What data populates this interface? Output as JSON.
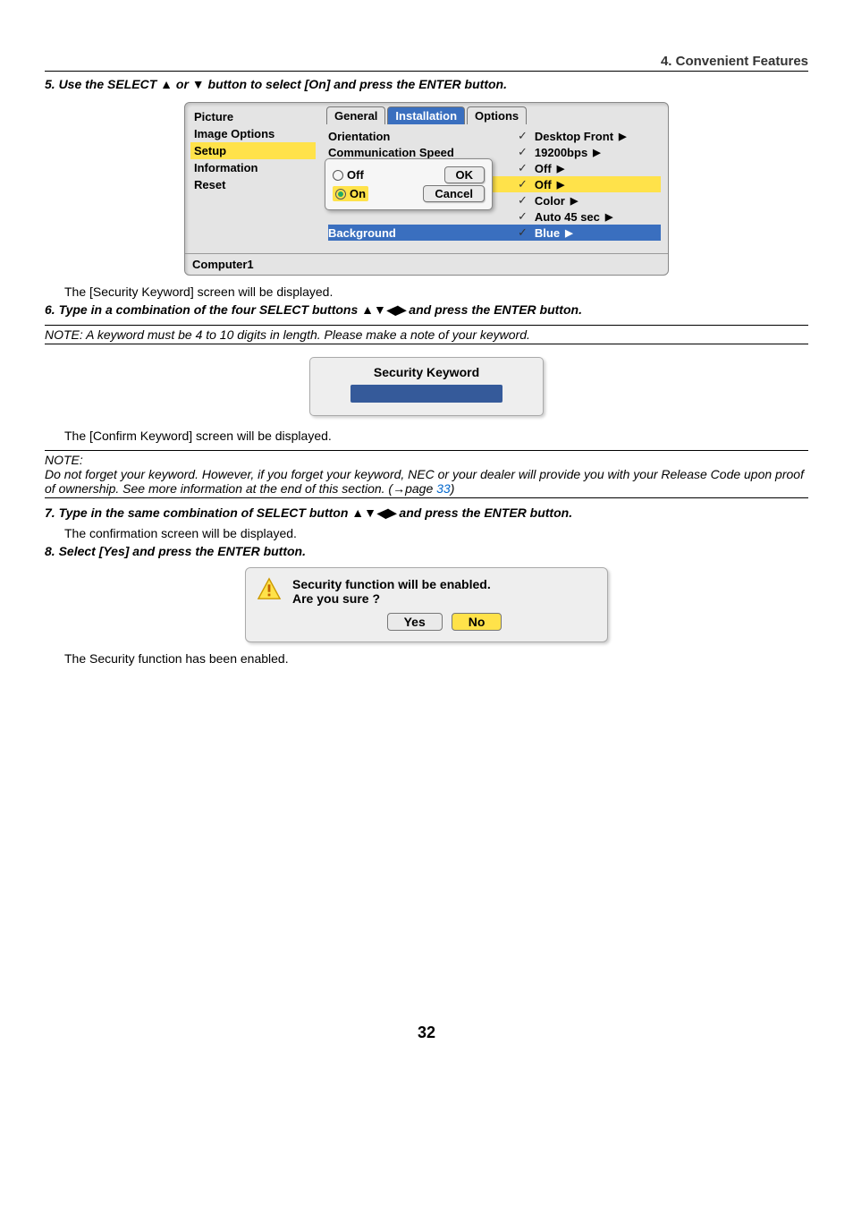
{
  "header": "4. Convenient Features",
  "step5": "5.  Use the SELECT ▲ or ▼ button to select [On] and press the ENTER button.",
  "menu": {
    "sidebar": [
      "Picture",
      "Image Options",
      "Setup",
      "Information",
      "Reset"
    ],
    "sidebar_hl_index": 2,
    "tabs": [
      "General",
      "Installation",
      "Options"
    ],
    "tab_sel_index": 1,
    "rows": [
      {
        "k": "Orientation",
        "v": "Desktop Front"
      },
      {
        "k": "Communication Speed",
        "v": "19200bps"
      },
      {
        "k": "",
        "v": "Off"
      },
      {
        "k": "",
        "v": "Off",
        "hl": true
      },
      {
        "k": "",
        "v": "Color"
      },
      {
        "k": "",
        "v": "Auto 45 sec"
      },
      {
        "k": "Background",
        "v": "Blue",
        "sel": true
      }
    ],
    "okbox": {
      "off": "Off",
      "on": "On",
      "ok": "OK",
      "cancel": "Cancel"
    },
    "footer": "Computer1"
  },
  "after5": "The [Security Keyword] screen will be displayed.",
  "step6": "6.  Type in a combination of the four SELECT buttons  ▲▼◀▶ and press the ENTER button.",
  "note1": "NOTE: A keyword must be 4 to 10  digits in length. Please make a note of your keyword.",
  "kw_title": "Security Keyword",
  "after6": "The [Confirm Keyword] screen will be displayed.",
  "note2_a": "NOTE:",
  "note2_b": "Do not forget your keyword. However, if you forget your keyword, NEC or your dealer will provide you with your Release Code upon proof of ownership. See more information at the end of this section. (→page ",
  "note2_link": "33",
  "note2_c": ")",
  "step7": "7.  Type in the same combination of SELECT button ▲▼◀▶  and press the ENTER button.",
  "after7": "The confirmation screen will be displayed.",
  "step8": "8.  Select [Yes] and press the ENTER button.",
  "confirm": {
    "line1": "Security function will be enabled.",
    "line2": "Are you sure ?",
    "yes": "Yes",
    "no": "No"
  },
  "after8": "The Security function has been enabled.",
  "page_number": "32"
}
